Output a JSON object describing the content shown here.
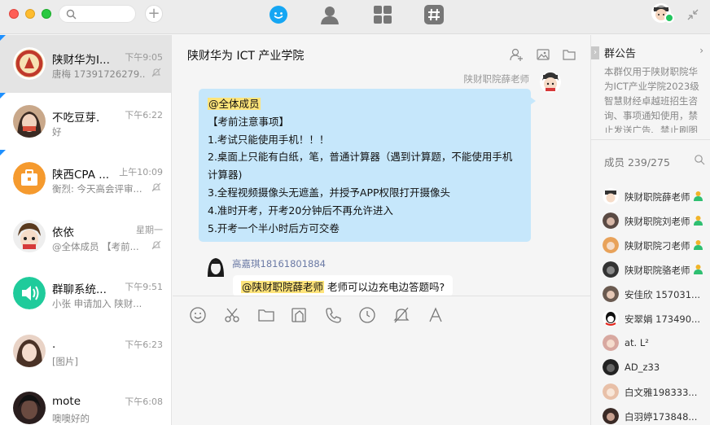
{
  "window": {
    "search_placeholder": "",
    "nav": [
      "chat-icon",
      "contacts-icon",
      "apps-icon",
      "channel-icon"
    ]
  },
  "conversations": [
    {
      "name": "陕财华为I...",
      "time": "下午9:05",
      "preview": "唐梅 17391726279...",
      "active": true,
      "flag": true,
      "muted": true,
      "avatar_color": "#c0392b"
    },
    {
      "name": "不吃豆芽.",
      "time": "下午6:22",
      "preview": "好",
      "active": false,
      "flag": true,
      "muted": false,
      "avatar_color": "#7a5a44"
    },
    {
      "name": "陕西CPA ...",
      "time": "上午10:09",
      "preview": "衡烈: 今天高会评审...",
      "active": false,
      "flag": true,
      "muted": true,
      "avatar_color": "#f59a2e"
    },
    {
      "name": "依依",
      "time": "星期一",
      "preview": "@全体成员 【考前...",
      "active": false,
      "flag": false,
      "muted": true,
      "avatar_color": "#ffffff"
    },
    {
      "name": "群聊系统...",
      "time": "下午9:51",
      "preview": "小张 申请加入 陕财...",
      "active": false,
      "flag": false,
      "muted": false,
      "avatar_color": "#1fcb9b"
    },
    {
      "name": ".",
      "time": "下午6:23",
      "preview": "[图片]",
      "active": false,
      "flag": false,
      "muted": false,
      "avatar_color": "#d9b8a6"
    },
    {
      "name": "mote",
      "time": "下午6:08",
      "preview": "噢噢好的",
      "active": false,
      "flag": false,
      "muted": false,
      "avatar_color": "#3a2a2a"
    }
  ],
  "chat": {
    "title": "陕财华为 ICT 产业学院",
    "sender_right": "陕财职院薛老师",
    "message_right": {
      "mention": "@全体成员",
      "lines": [
        "【考前注意事项】",
        "1.考试只能使用手机！！！",
        "2.桌面上只能有白纸，笔，普通计算器（遇到计算题，不能使用手机",
        "计算器)",
        "3.全程视频摄像头无遮盖，并授予APP权限打开摄像头",
        "4.准时开考，开考20分钟后不再允许进入",
        "5.开考一个半小时后方可交卷"
      ]
    },
    "sender_left": "高嘉琪18161801884",
    "message_left": {
      "mention": "@陕财职院薛老师",
      "text": " 老师可以边充电边答题吗?"
    },
    "tools": [
      "emoji-icon",
      "scissors-icon",
      "folder-icon",
      "image-icon",
      "phone-icon",
      "clock-icon",
      "bell-off-icon",
      "font-icon"
    ]
  },
  "sidebar": {
    "notice_title": "群公告",
    "notice_body": "本群仅用于陕财职院华为ICT产业学院2023级智慧财经卓越班招生咨询、事项通知使用，禁止发送广告、禁止刷图",
    "members_label": "成员 239/275",
    "members": [
      {
        "name": "陕财职院薛老师",
        "admin": true
      },
      {
        "name": "陕财职院刘老师",
        "admin": true
      },
      {
        "name": "陕财职院刁老师",
        "admin": true
      },
      {
        "name": "陕财职院骆老师",
        "admin": true
      },
      {
        "name": "安佳欣 157031...",
        "admin": false
      },
      {
        "name": "安翠娟 173490...",
        "admin": false
      },
      {
        "name": "at. L²",
        "admin": false
      },
      {
        "name": "AD_z33",
        "admin": false
      },
      {
        "name": "白文雅198333...",
        "admin": false
      },
      {
        "name": "白羽婷173848...",
        "admin": false
      }
    ]
  }
}
